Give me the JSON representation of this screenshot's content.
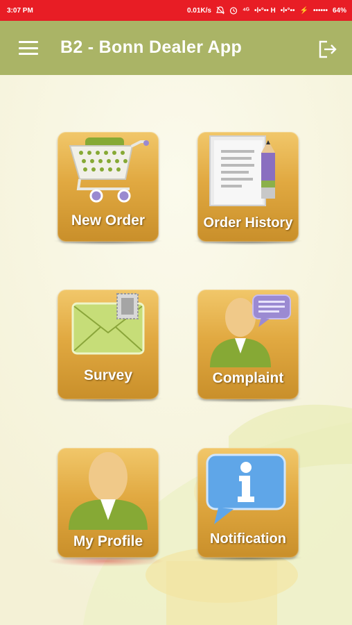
{
  "status_bar": {
    "time": "3:07 PM",
    "net_speed": "0.01K/s",
    "volte": "⁴ᴳ",
    "signal_1": "•l•°•• H",
    "signal_2": "•l•°••",
    "signal_3": "••••••",
    "battery": "64%",
    "background_color": "#e81d25"
  },
  "app_bar": {
    "title": "B2 - Bonn Dealer App",
    "menu_icon": "hamburger-menu-icon",
    "logout_icon": "logout-icon",
    "background_color": "#aab466"
  },
  "tiles": [
    {
      "label": "New Order",
      "icon": "shopping-cart-icon"
    },
    {
      "label": "Order History",
      "icon": "document-pencil-icon"
    },
    {
      "label": "Survey",
      "icon": "envelope-icon"
    },
    {
      "label": "Complaint",
      "icon": "person-speech-bubble-icon"
    },
    {
      "label": "My Profile",
      "icon": "person-icon"
    },
    {
      "label": "Notification",
      "icon": "info-bubble-icon"
    }
  ],
  "colors": {
    "tile_gold": "#e1a941",
    "icon_green": "#8aa53a",
    "page_background": "#f7f5e4"
  }
}
